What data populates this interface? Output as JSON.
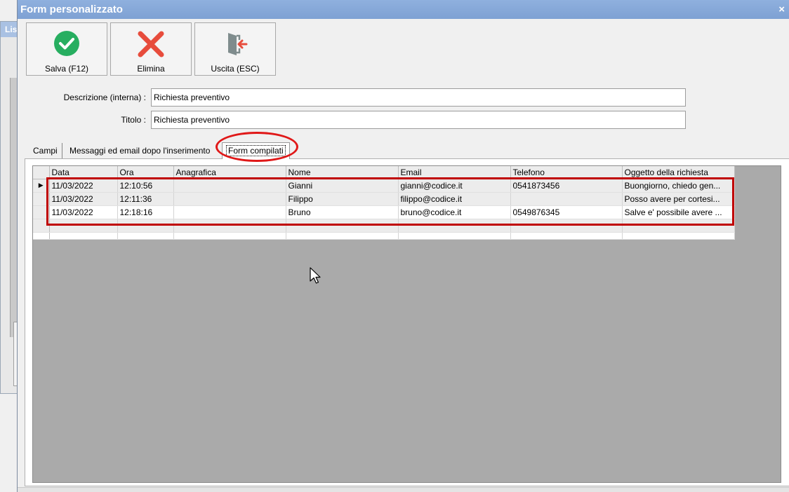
{
  "background_window": {
    "title": "Lis"
  },
  "dialog": {
    "title": "Form personalizzato",
    "close_glyph": "×"
  },
  "toolbar": {
    "save_label": "Salva (F12)",
    "delete_label": "Elimina",
    "exit_label": "Uscita (ESC)"
  },
  "form": {
    "description_label": "Descrizione (interna) :",
    "description_value": "Richiesta preventivo",
    "title_label": "Titolo :",
    "title_value": "Richiesta preventivo"
  },
  "tabs": [
    {
      "label": "Campi"
    },
    {
      "label": "Messaggi ed email dopo l'inserimento"
    },
    {
      "label": "Form compilati"
    }
  ],
  "grid": {
    "columns": [
      "Data",
      "Ora",
      "Anagrafica",
      "Nome",
      "Email",
      "Telefono",
      "Oggetto della richiesta"
    ],
    "rows": [
      {
        "data": "11/03/2022",
        "ora": "12:10:56",
        "anagrafica": "",
        "nome": "Gianni",
        "email": "gianni@codice.it",
        "telefono": "0541873456",
        "oggetto": "Buongiorno, chiedo gen..."
      },
      {
        "data": "11/03/2022",
        "ora": "12:11:36",
        "anagrafica": "",
        "nome": "Filippo",
        "email": "filippo@codice.it",
        "telefono": "",
        "oggetto": "Posso avere per cortesi..."
      },
      {
        "data": "11/03/2022",
        "ora": "12:18:16",
        "anagrafica": "",
        "nome": "Bruno",
        "email": "bruno@codice.it",
        "telefono": "0549876345",
        "oggetto": "Salve e' possibile avere ..."
      }
    ],
    "current_row_marker": "▶"
  },
  "colors": {
    "annotation_red": "#e01818",
    "save_green": "#27ae60",
    "delete_red": "#e74c3c"
  }
}
